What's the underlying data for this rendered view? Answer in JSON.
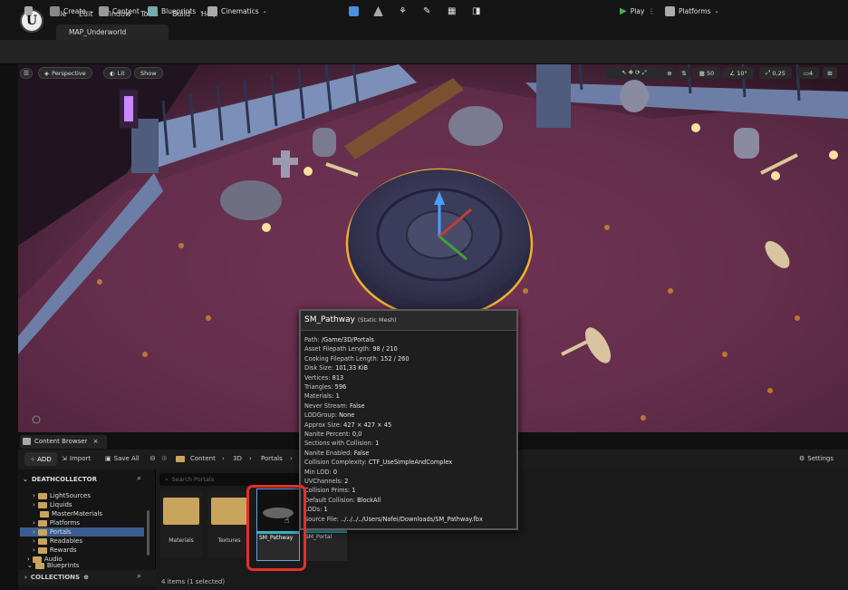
{
  "menubar": {
    "items": [
      "File",
      "Edit",
      "Window",
      "Tools",
      "Build",
      "Help"
    ]
  },
  "level_tab": "MAP_Underworld",
  "toolbar": {
    "create": "Create",
    "content": "Content",
    "blueprints": "Blueprints",
    "cinematics": "Cinematics",
    "play": "Play",
    "platforms": "Platforms"
  },
  "viewport": {
    "perspective": "Perspective",
    "lit": "Lit",
    "show": "Show",
    "grid_snap": "50",
    "angle_snap": "10°",
    "scale_snap": "0,25",
    "camera_speed": "4"
  },
  "content_browser": {
    "tab": "Content Browser",
    "add": "ADD",
    "import": "Import",
    "save_all": "Save All",
    "breadcrumb": [
      "Content",
      "3D",
      "Portals"
    ],
    "settings": "Settings",
    "root": "DEATHCOLLECTOR",
    "tree": [
      "LightSources",
      "Liquids",
      "MasterMaterials",
      "Platforms",
      "Portals",
      "Readables",
      "Rewards",
      "Audio",
      "Blueprints"
    ],
    "selected_folder": "Portals",
    "collections": "COLLECTIONS",
    "search_placeholder": "Search Portals",
    "assets": [
      {
        "name": "Materials",
        "kind": "folder"
      },
      {
        "name": "Textures",
        "kind": "folder"
      },
      {
        "name": "SM_Pathway",
        "kind": "mesh"
      },
      {
        "name": "SM_Portal",
        "kind": "mesh"
      }
    ],
    "status": "4 items (1 selected)"
  },
  "tooltip": {
    "title": "SM_Pathway",
    "type": "(Static Mesh)",
    "rows": [
      {
        "k": "Path:",
        "v": "/Game/3D/Portals"
      },
      {
        "k": "Asset Filepath Length:",
        "v": "98 / 210"
      },
      {
        "k": "Cooking Filepath Length:",
        "v": "152 / 260"
      },
      {
        "k": "Disk Size:",
        "v": "101,33 KiB"
      },
      {
        "k": "Vertices:",
        "v": "813"
      },
      {
        "k": "Triangles:",
        "v": "596"
      },
      {
        "k": "Materials:",
        "v": "1"
      },
      {
        "k": "Never Stream:",
        "v": "False"
      },
      {
        "k": "LODGroup:",
        "v": "None"
      },
      {
        "k": "Approx Size:",
        "v": "427 × 427 × 45"
      },
      {
        "k": "Nanite Percent:",
        "v": "0,0"
      },
      {
        "k": "Sections with Collision:",
        "v": "1"
      },
      {
        "k": "Nanite Enabled:",
        "v": "False"
      },
      {
        "k": "Collision Complexity:",
        "v": "CTF_UseSimpleAndComplex"
      },
      {
        "k": "Min LOD:",
        "v": "0"
      },
      {
        "k": "UVChannels:",
        "v": "2"
      },
      {
        "k": "Collision Prims:",
        "v": "1"
      },
      {
        "k": "Default Collision:",
        "v": "BlockAll"
      },
      {
        "k": "LODs:",
        "v": "1"
      },
      {
        "k": "Source File:",
        "v": "../../../../Users/Nafei/Downloads/SM_Pathway.fbx"
      }
    ]
  },
  "colors": {
    "selection_red": "#e0312a",
    "play_green": "#4caf50",
    "portal_outline": "#f0b030"
  }
}
